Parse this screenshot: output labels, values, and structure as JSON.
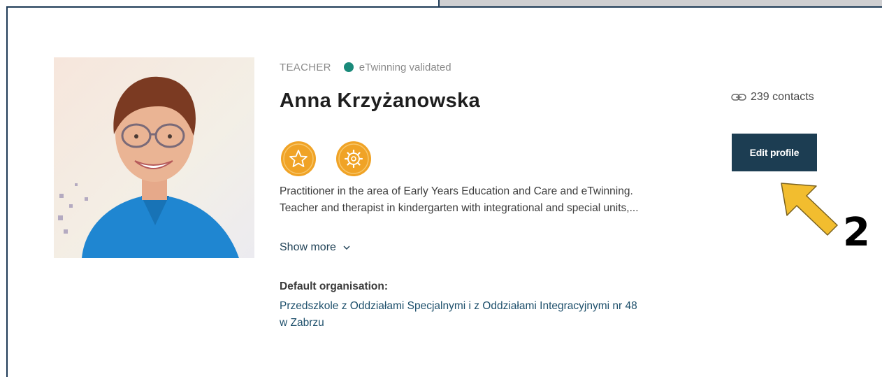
{
  "profile": {
    "role": "TEACHER",
    "validation_label": "eTwinning validated",
    "validation_color": "#1a8a7a",
    "name": "Anna Krzyżanowska",
    "badges": [
      "star-badge-icon",
      "gear-badge-icon"
    ],
    "bio_line1": "Practitioner in the area of Early Years Education and Care and eTwinning.",
    "bio_line2": "Teacher and therapist in kindergarten with integrational and special units,...",
    "show_more_label": "Show more",
    "org_label": "Default organisation:",
    "org_line1": "Przedszkole z Oddziałami Specjalnymi i z Oddziałami Integracyjnymi nr 48",
    "org_line2": "w Zabrzu"
  },
  "sidebar": {
    "contacts_label": "239 contacts",
    "edit_button_label": "Edit profile"
  },
  "annotation": {
    "step_number": "2",
    "arrow_color": "#f2bd2f"
  },
  "colors": {
    "primary": "#1c3d52",
    "badge": "#f0a326",
    "link": "#1d4f6b"
  }
}
